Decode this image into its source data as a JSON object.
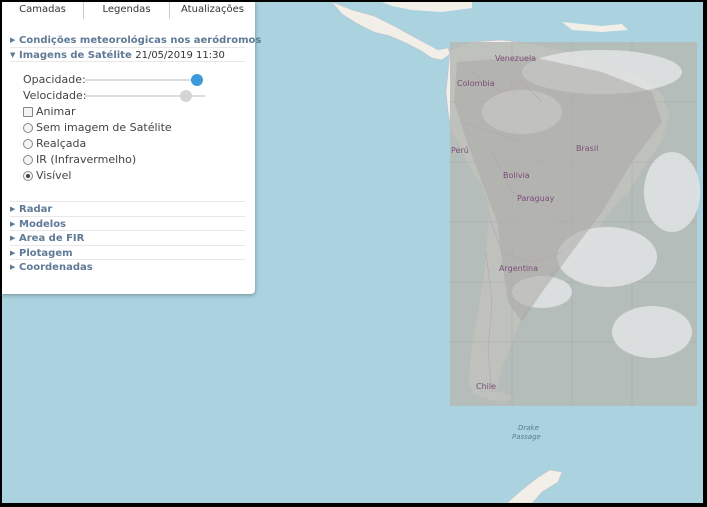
{
  "tabs": [
    {
      "label": "Camadas"
    },
    {
      "label": "Legendas"
    },
    {
      "label": "Atualizações"
    }
  ],
  "sections": {
    "aerodromos": "Condições meteorológicas nos aeródromos",
    "satelite": {
      "label": "Imagens de Satélite",
      "timestamp": "21/05/2019 11:30",
      "opacidade_label": "Opacidade:",
      "opacidade_level": 1.0,
      "velocidade_label": "Velocidade:",
      "velocidade_level": 0.88,
      "animar_label": "Animar",
      "animar_checked": false,
      "options": [
        {
          "label": "Sem imagem de Satélite",
          "selected": false
        },
        {
          "label": "Realçada",
          "selected": false
        },
        {
          "label": "IR (Infravermelho)",
          "selected": false
        },
        {
          "label": "Visível",
          "selected": true
        }
      ]
    },
    "collapsed": [
      {
        "label": "Radar"
      },
      {
        "label": "Modelos"
      },
      {
        "label": "Area de FIR"
      },
      {
        "label": "Plotagem"
      },
      {
        "label": "Coordenadas"
      }
    ]
  },
  "map": {
    "countries": [
      "Venezuela",
      "Colombia",
      "Perú",
      "Brasil",
      "Bolivia",
      "Paraguay",
      "Argentina",
      "Chile"
    ],
    "ocean_labels": [
      "Drake",
      "Passage"
    ]
  },
  "colors": {
    "ocean": "#aad3df",
    "land": "#f2efe9",
    "satellite": "#b6b8b4",
    "accent": "#3d9ad9",
    "section_text": "#5f7a96"
  }
}
